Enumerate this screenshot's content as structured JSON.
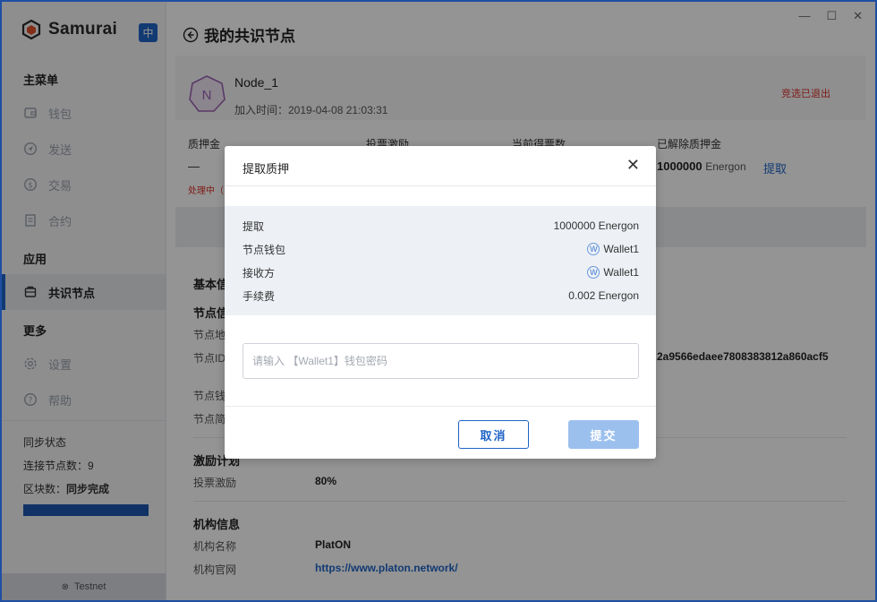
{
  "app": {
    "name": "Samurai",
    "lang_badge": "中"
  },
  "sidebar": {
    "main_menu_title": "主菜单",
    "items": [
      {
        "label": "钱包",
        "icon": "wallet-icon"
      },
      {
        "label": "发送",
        "icon": "send-icon"
      },
      {
        "label": "交易",
        "icon": "transaction-icon"
      },
      {
        "label": "合约",
        "icon": "contract-icon"
      }
    ],
    "app_title": "应用",
    "app_items": [
      {
        "label": "共识节点",
        "icon": "node-icon",
        "active": true
      }
    ],
    "more_title": "更多",
    "more_items": [
      {
        "label": "设置",
        "icon": "gear-icon"
      },
      {
        "label": "帮助",
        "icon": "help-icon"
      }
    ],
    "sync": {
      "title": "同步状态",
      "peers_label": "连接节点数：",
      "peers_value": "9",
      "block_label": "区块数：",
      "block_value": "同步完成",
      "progress": 1.0
    },
    "network": "Testnet"
  },
  "header": {
    "title": "我的共识节点"
  },
  "node": {
    "avatar_letter": "N",
    "name": "Node_1",
    "join_time": "加入时间：2019-04-08 21:03:31",
    "status": "竞选已退出"
  },
  "stats": {
    "deposit_label": "质押金",
    "deposit_value": "—",
    "processing": "处理中（",
    "vote_reward_label": "投票激励",
    "current_ticket_label": "当前得票数",
    "released_label": "已解除质押金",
    "released_value": "1000000",
    "released_unit": "Energon",
    "withdraw_link": "提取"
  },
  "details": {
    "basic_title": "基本信",
    "node_info_title": "节点信",
    "addr_label": "节点地",
    "id_label": "节点ID",
    "id_value": "2a9566edaee7808383812a860acf5",
    "wallet_label": "节点钱",
    "intro_label": "节点简",
    "incentive_title": "激励计划",
    "vote_reward_label": "投票激励",
    "vote_reward_value": "80%",
    "org_title": "机构信息",
    "org_name_label": "机构名称",
    "org_name_value": "PlatON",
    "org_site_label": "机构官网",
    "org_site_value": "https://www.platon.network/"
  },
  "modal": {
    "title": "提取质押",
    "rows": [
      {
        "label": "提取",
        "value": "1000000 Energon",
        "wallet": false
      },
      {
        "label": "节点钱包",
        "value": "Wallet1",
        "wallet": true
      },
      {
        "label": "接收方",
        "value": "Wallet1",
        "wallet": true
      },
      {
        "label": "手续费",
        "value": "0.002 Energon",
        "wallet": false
      }
    ],
    "password_placeholder": "请输入 【Wallet1】钱包密码",
    "cancel_label": "取消",
    "submit_label": "提交"
  }
}
